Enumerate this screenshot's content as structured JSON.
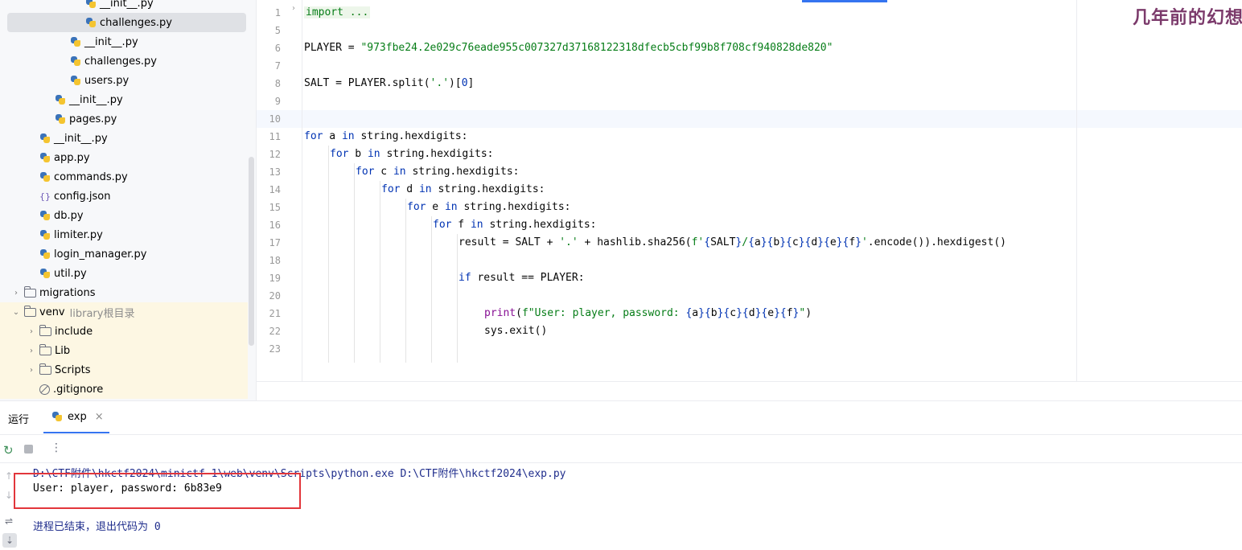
{
  "project_tree": {
    "items": [
      {
        "label": "__init__.py",
        "icon": "python-file-icon",
        "level": 5
      },
      {
        "label": "challenges.py",
        "icon": "python-file-icon",
        "level": 5,
        "selected": true
      },
      {
        "label": "__init__.py",
        "icon": "python-file-icon",
        "level": 4
      },
      {
        "label": "challenges.py",
        "icon": "python-file-icon",
        "level": 4
      },
      {
        "label": "users.py",
        "icon": "python-file-icon",
        "level": 4
      },
      {
        "label": "__init__.py",
        "icon": "python-file-icon",
        "level": 3
      },
      {
        "label": "pages.py",
        "icon": "python-file-icon",
        "level": 3
      },
      {
        "label": "__init__.py",
        "icon": "python-file-icon",
        "level": 2
      },
      {
        "label": "app.py",
        "icon": "python-file-icon",
        "level": 2
      },
      {
        "label": "commands.py",
        "icon": "python-file-icon",
        "level": 2
      },
      {
        "label": "config.json",
        "icon": "json-file-icon",
        "level": 2
      },
      {
        "label": "db.py",
        "icon": "python-file-icon",
        "level": 2
      },
      {
        "label": "limiter.py",
        "icon": "python-file-icon",
        "level": 2
      },
      {
        "label": "login_manager.py",
        "icon": "python-file-icon",
        "level": 2
      },
      {
        "label": "util.py",
        "icon": "python-file-icon",
        "level": 2
      },
      {
        "label": "migrations",
        "icon": "folder-icon",
        "level": 1,
        "expanded": false
      },
      {
        "label": "venv",
        "icon": "folder-icon",
        "level": 1,
        "expanded": true,
        "note": "library根目录"
      },
      {
        "label": "include",
        "icon": "folder-icon",
        "level": 2,
        "expanded": false
      },
      {
        "label": "Lib",
        "icon": "folder-icon",
        "level": 2,
        "expanded": false
      },
      {
        "label": "Scripts",
        "icon": "folder-icon",
        "level": 2,
        "expanded": false
      },
      {
        "label": ".gitignore",
        "icon": "ignore-file-icon",
        "level": 2
      }
    ]
  },
  "editor": {
    "lines": [
      {
        "num": "1",
        "indent": 0,
        "tokens": [
          {
            "t": "fold",
            "v": "import ..."
          }
        ]
      },
      {
        "num": "5",
        "indent": 0,
        "tokens": []
      },
      {
        "num": "6",
        "indent": 0,
        "tokens": [
          {
            "t": "plain",
            "v": "PLAYER = "
          },
          {
            "t": "str",
            "v": "\"973fbe24.2e029c76eade955c007327d37168122318dfecb5cbf99b8f708cf940828de820\""
          }
        ]
      },
      {
        "num": "7",
        "indent": 0,
        "tokens": []
      },
      {
        "num": "8",
        "indent": 0,
        "tokens": [
          {
            "t": "plain",
            "v": "SALT = PLAYER.split("
          },
          {
            "t": "str",
            "v": "'.'"
          },
          {
            "t": "plain",
            "v": ")["
          },
          {
            "t": "kw",
            "v": "0"
          },
          {
            "t": "plain",
            "v": "]"
          }
        ]
      },
      {
        "num": "9",
        "indent": 0,
        "tokens": []
      },
      {
        "num": "10",
        "indent": 0,
        "tokens": [],
        "current": true
      },
      {
        "num": "11",
        "indent": 0,
        "tokens": [
          {
            "t": "kw",
            "v": "for"
          },
          {
            "t": "plain",
            "v": " a "
          },
          {
            "t": "kw",
            "v": "in"
          },
          {
            "t": "plain",
            "v": " string.hexdigits:"
          }
        ]
      },
      {
        "num": "12",
        "indent": 1,
        "tokens": [
          {
            "t": "kw",
            "v": "for"
          },
          {
            "t": "plain",
            "v": " b "
          },
          {
            "t": "kw",
            "v": "in"
          },
          {
            "t": "plain",
            "v": " string.hexdigits:"
          }
        ]
      },
      {
        "num": "13",
        "indent": 2,
        "tokens": [
          {
            "t": "kw",
            "v": "for"
          },
          {
            "t": "plain",
            "v": " c "
          },
          {
            "t": "kw",
            "v": "in"
          },
          {
            "t": "plain",
            "v": " string.hexdigits:"
          }
        ]
      },
      {
        "num": "14",
        "indent": 3,
        "tokens": [
          {
            "t": "kw",
            "v": "for"
          },
          {
            "t": "plain",
            "v": " d "
          },
          {
            "t": "kw",
            "v": "in"
          },
          {
            "t": "plain",
            "v": " string.hexdigits:"
          }
        ]
      },
      {
        "num": "15",
        "indent": 4,
        "tokens": [
          {
            "t": "kw",
            "v": "for"
          },
          {
            "t": "plain",
            "v": " e "
          },
          {
            "t": "kw",
            "v": "in"
          },
          {
            "t": "plain",
            "v": " string.hexdigits:"
          }
        ]
      },
      {
        "num": "16",
        "indent": 5,
        "tokens": [
          {
            "t": "kw",
            "v": "for"
          },
          {
            "t": "plain",
            "v": " f "
          },
          {
            "t": "kw",
            "v": "in"
          },
          {
            "t": "plain",
            "v": " string.hexdigits:"
          }
        ]
      },
      {
        "num": "17",
        "indent": 6,
        "tokens": [
          {
            "t": "plain",
            "v": "result = SALT + "
          },
          {
            "t": "str",
            "v": "'.'"
          },
          {
            "t": "plain",
            "v": " + hashlib.sha256("
          },
          {
            "t": "str",
            "v": "f'"
          },
          {
            "t": "kw",
            "v": "{"
          },
          {
            "t": "plain",
            "v": "SALT"
          },
          {
            "t": "kw",
            "v": "}"
          },
          {
            "t": "str",
            "v": "/"
          },
          {
            "t": "kw",
            "v": "{"
          },
          {
            "t": "plain",
            "v": "a"
          },
          {
            "t": "kw",
            "v": "}{"
          },
          {
            "t": "plain",
            "v": "b"
          },
          {
            "t": "kw",
            "v": "}{"
          },
          {
            "t": "plain",
            "v": "c"
          },
          {
            "t": "kw",
            "v": "}{"
          },
          {
            "t": "plain",
            "v": "d"
          },
          {
            "t": "kw",
            "v": "}{"
          },
          {
            "t": "plain",
            "v": "e"
          },
          {
            "t": "kw",
            "v": "}{"
          },
          {
            "t": "plain",
            "v": "f"
          },
          {
            "t": "kw",
            "v": "}"
          },
          {
            "t": "str",
            "v": "'"
          },
          {
            "t": "plain",
            "v": ".encode()).hexdigest()"
          }
        ]
      },
      {
        "num": "18",
        "indent": 6,
        "tokens": []
      },
      {
        "num": "19",
        "indent": 6,
        "tokens": [
          {
            "t": "kw",
            "v": "if"
          },
          {
            "t": "plain",
            "v": " result == PLAYER:"
          }
        ]
      },
      {
        "num": "20",
        "indent": 6,
        "tokens": []
      },
      {
        "num": "21",
        "indent": 7,
        "tokens": [
          {
            "t": "fn",
            "v": "print"
          },
          {
            "t": "plain",
            "v": "("
          },
          {
            "t": "str",
            "v": "f\"User: player, password: "
          },
          {
            "t": "kw",
            "v": "{"
          },
          {
            "t": "plain",
            "v": "a"
          },
          {
            "t": "kw",
            "v": "}{"
          },
          {
            "t": "plain",
            "v": "b"
          },
          {
            "t": "kw",
            "v": "}{"
          },
          {
            "t": "plain",
            "v": "c"
          },
          {
            "t": "kw",
            "v": "}{"
          },
          {
            "t": "plain",
            "v": "d"
          },
          {
            "t": "kw",
            "v": "}{"
          },
          {
            "t": "plain",
            "v": "e"
          },
          {
            "t": "kw",
            "v": "}{"
          },
          {
            "t": "plain",
            "v": "f"
          },
          {
            "t": "kw",
            "v": "}"
          },
          {
            "t": "str",
            "v": "\""
          },
          {
            "t": "plain",
            "v": ")"
          }
        ]
      },
      {
        "num": "22",
        "indent": 7,
        "tokens": [
          {
            "t": "plain",
            "v": "sys.exit()"
          }
        ]
      },
      {
        "num": "23",
        "indent": 7,
        "tokens": []
      }
    ]
  },
  "watermark": "几年前的幻想",
  "run_panel": {
    "title": "运行",
    "tab_label": "exp",
    "tab_close": "×",
    "console": {
      "command": "D:\\CTF附件\\hkctf2024\\minictf-1\\web\\venv\\Scripts\\python.exe D:\\CTF附件\\hkctf2024\\exp.py",
      "output": "User: player, password: 6b83e9",
      "exit_message_prefix": "进程已结束，退出代码为 ",
      "exit_code": "0"
    }
  },
  "colors": {
    "keyword": "#0033b3",
    "string": "#067d17",
    "function": "#871094",
    "highlight_box": "#e2363b",
    "accent": "#3574f0"
  }
}
